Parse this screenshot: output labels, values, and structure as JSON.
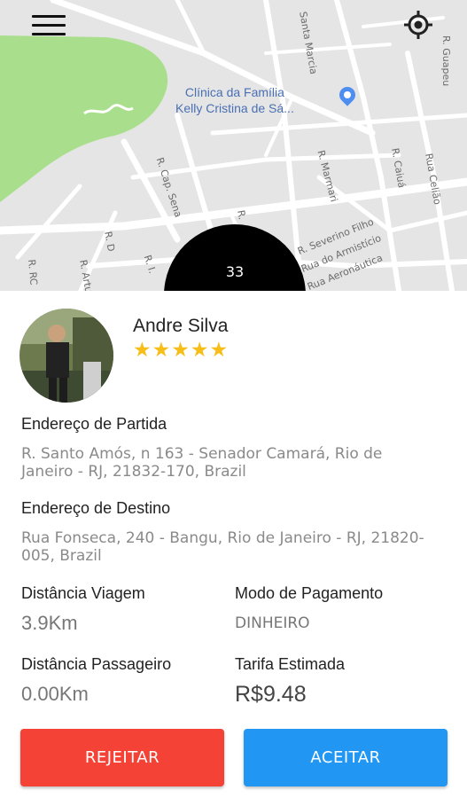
{
  "map": {
    "poi_line1": "Clínica da Família",
    "poi_line2": "Kelly Cristina de Sá...",
    "streets": [
      "Santa Marcia",
      "R. Guapeu",
      "R. Cap. Sena",
      "R. Marmari",
      "R. Caiuá",
      "Rua Celião",
      "R. Severino Filho",
      "Rua do Armistício",
      "Rua Aeronáutica",
      "R. D",
      "R. Artur",
      "R. RC",
      "R. I.",
      "R."
    ],
    "timer": "33",
    "park_color": "#a9df8c"
  },
  "driver": {
    "name": "Andre Silva",
    "stars": "★★★★★",
    "rating": 5
  },
  "pickup": {
    "label": "Endereço de Partida",
    "value": "R. Santo Amós, n 163 - Senador Camará, Rio de Janeiro - RJ, 21832-170, Brazil"
  },
  "destination": {
    "label": "Endereço de Destino",
    "value": "Rua Fonseca, 240 - Bangu, Rio de Janeiro - RJ, 21820-005, Brazil"
  },
  "trip_distance": {
    "label": "Distância Viagem",
    "value": "3.9Km"
  },
  "payment_mode": {
    "label": "Modo de Pagamento",
    "value": "DINHEIRO"
  },
  "passenger_distance": {
    "label": "Distância Passageiro",
    "value": "0.00Km"
  },
  "estimated_fare": {
    "label": "Tarifa Estimada",
    "value": "R$9.48"
  },
  "actions": {
    "reject": "REJEITAR",
    "accept": "ACEITAR",
    "reject_color": "#f44336",
    "accept_color": "#2196f3"
  }
}
